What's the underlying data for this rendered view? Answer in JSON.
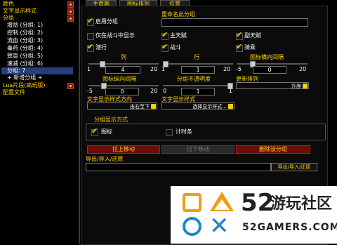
{
  "sidebar": {
    "items": [
      {
        "label": "颜色",
        "level": 0
      },
      {
        "label": "文字显示样式",
        "level": 0
      },
      {
        "label": "分组",
        "level": 0
      },
      {
        "label": "增益 (分组: 1)",
        "level": 1
      },
      {
        "label": "控制 (分组: 2)",
        "level": 1
      },
      {
        "label": "流血 (分组: 3)",
        "level": 1
      },
      {
        "label": "毒药 (分组: 4)",
        "level": 1
      },
      {
        "label": "致盲 (分组: 5)",
        "level": 1
      },
      {
        "label": "速减 (分组: 6)",
        "level": 1
      },
      {
        "label": "分组: 7",
        "level": 1,
        "selected": true
      },
      {
        "label": "+ 新增分组 +",
        "level": 1
      },
      {
        "label": "Lua片段(高玩版)",
        "level": 0
      },
      {
        "label": "配置文件",
        "level": 0
      }
    ]
  },
  "tabs": [
    "主页面",
    "图标排列",
    "位置"
  ],
  "main": {
    "enable_group": "启用分组",
    "rename_group": "重命名此分组",
    "only_in_combat": "仅在战斗中显示",
    "master_talent": "主天赋",
    "sub_talent": "副天赋",
    "stealth": "潜行",
    "combat": "战斗",
    "mounted": "骑乘",
    "columns": {
      "label": "列",
      "min": "1",
      "value": "4",
      "max": "20"
    },
    "rows": {
      "label": "行",
      "min": "1",
      "value": "1",
      "max": "20"
    },
    "h_spacing": {
      "label": "图标横向间隔",
      "min": "-5",
      "value": "0",
      "max": "20"
    },
    "v_spacing": {
      "label": "图标纵向间隔",
      "min": "-5",
      "value": "0",
      "max": "20"
    },
    "opacity": {
      "label": "分组不透明度",
      "min": "0",
      "value": "1",
      "max": "1"
    },
    "update_order": {
      "label": "更新排列",
      "value": "升序"
    },
    "text_direction": {
      "label": "文字显示样式方向",
      "value": "由右至下"
    },
    "text_style": {
      "label": "文字显示样式",
      "value": "选择显示样式..."
    },
    "display_mode": "分组显示方式",
    "icon_opt": "图标",
    "timer_opt": "计时条",
    "btn_move": "拉上移动",
    "btn_move_disabled": "拉下移动",
    "btn_delete": "删除该分组",
    "export_label": "导出/导入/还原",
    "export_btn": "导出/导入/还原"
  },
  "watermark": {
    "number": "52",
    "text_cn": "游玩社区",
    "url": "52GAMERS.COM"
  },
  "colors": {
    "accent": "#ffd100",
    "button_red": "#6b0d0d",
    "selected": "#24407a"
  }
}
